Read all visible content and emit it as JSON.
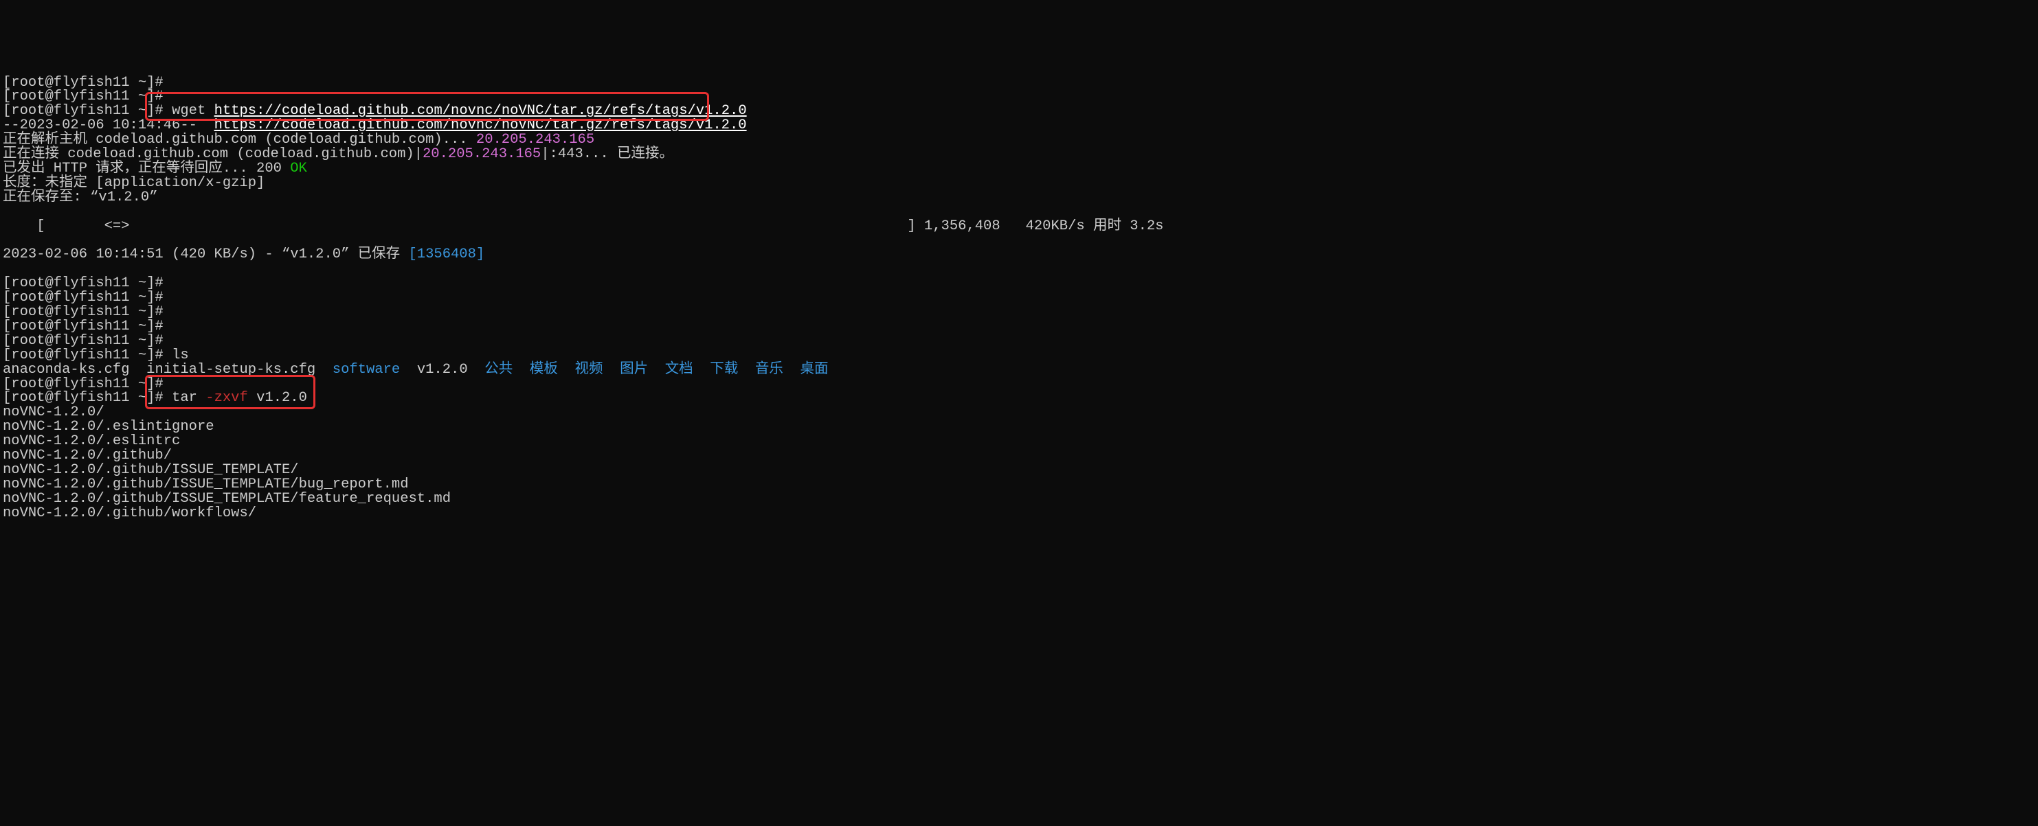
{
  "prompt": "[root@flyfish11 ~]#",
  "cmd_wget": "wget",
  "url": "https://codeload.github.com/novnc/noVNC/tar.gz/refs/tags/v1.2.0",
  "ts_line_a": "--2023-02-06 10:14:46--  ",
  "resolve_a": "正在解析主机 codeload.github.com (codeload.github.com)... ",
  "ip": "20.205.243.165",
  "connect_a": "正在连接 codeload.github.com (codeload.github.com)|",
  "connect_b": "|:443... 已连接。",
  "httpreq": "已发出 HTTP 请求，正在等待回应... 200 ",
  "ok": "OK",
  "len_line": "长度：未指定 [application/x-gzip]",
  "saving": "正在保存至: “v1.2.0”",
  "progress_left": "    [       ",
  "progress_marker": "<=>",
  "progress_right_pad": "                                                                                            ",
  "progress_bytes": "] 1,356,408   420KB/s 用时 3.2s",
  "done_a": "2023-02-06 10:14:51 (420 KB/s) - “v1.2.0” 已保存 ",
  "done_bytes": "[1356408]",
  "cmd_ls": "ls",
  "ls_items": {
    "a": "anaconda-ks.cfg",
    "b": "initial-setup-ks.cfg",
    "c": "software",
    "d": "v1.2.0",
    "e": "公共",
    "f": "模板",
    "g": "视频",
    "h": "图片",
    "i": "文档",
    "j": "下载",
    "k": "音乐",
    "l": "桌面"
  },
  "cmd_tar": "tar ",
  "tar_opt": "-zxvf",
  "tar_arg": " v1.2.0",
  "tar_out": [
    "noVNC-1.2.0/",
    "noVNC-1.2.0/.eslintignore",
    "noVNC-1.2.0/.eslintrc",
    "noVNC-1.2.0/.github/",
    "noVNC-1.2.0/.github/ISSUE_TEMPLATE/",
    "noVNC-1.2.0/.github/ISSUE_TEMPLATE/bug_report.md",
    "noVNC-1.2.0/.github/ISSUE_TEMPLATE/feature_request.md",
    "noVNC-1.2.0/.github/workflows/"
  ]
}
